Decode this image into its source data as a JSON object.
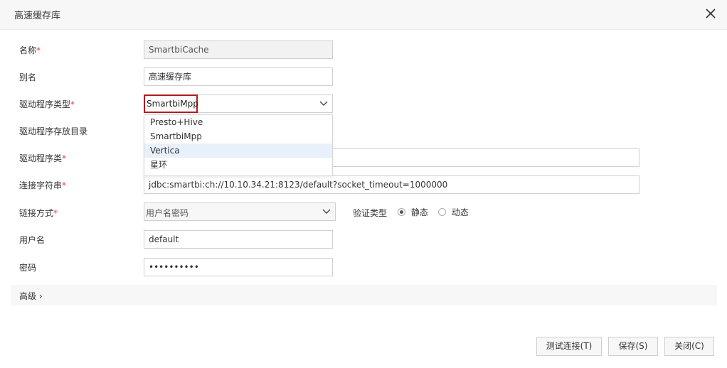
{
  "dialog": {
    "title": "高速缓存库"
  },
  "form": {
    "name": {
      "label": "名称",
      "value": "SmartbiCache"
    },
    "alias": {
      "label": "别名",
      "value": "高速缓存库"
    },
    "driver_type": {
      "label": "驱动程序类型",
      "selected": "SmartbiMpp"
    },
    "driver_dir": {
      "label": "驱动程序存放目录"
    },
    "driver_class": {
      "label": "驱动程序类",
      "value": ""
    },
    "conn_string": {
      "label": "连接字符串",
      "value": "jdbc:smartbi:ch://10.10.34.21:8123/default?socket_timeout=1000000"
    },
    "link_mode": {
      "label": "链接方式",
      "selected": "用户名密码"
    },
    "auth_type": {
      "label": "验证类型",
      "options": [
        "静态",
        "动态"
      ],
      "selected": "静态"
    },
    "username": {
      "label": "用户名",
      "value": "default"
    },
    "password": {
      "label": "密码",
      "masked": "••••••••••"
    },
    "required_mark": "*"
  },
  "dropdown": {
    "options": [
      "Presto+Hive",
      "SmartbiMpp",
      "Vertica",
      "星环"
    ],
    "highlighted": "Vertica"
  },
  "advanced": {
    "label": "高级 ›"
  },
  "buttons": {
    "test": "测试连接(T)",
    "save": "保存(S)",
    "close": "关闭(C)"
  },
  "colors": {
    "highlight_border": "#b01c22",
    "required": "#e0453a",
    "hover_bg": "#e8f1fb"
  }
}
